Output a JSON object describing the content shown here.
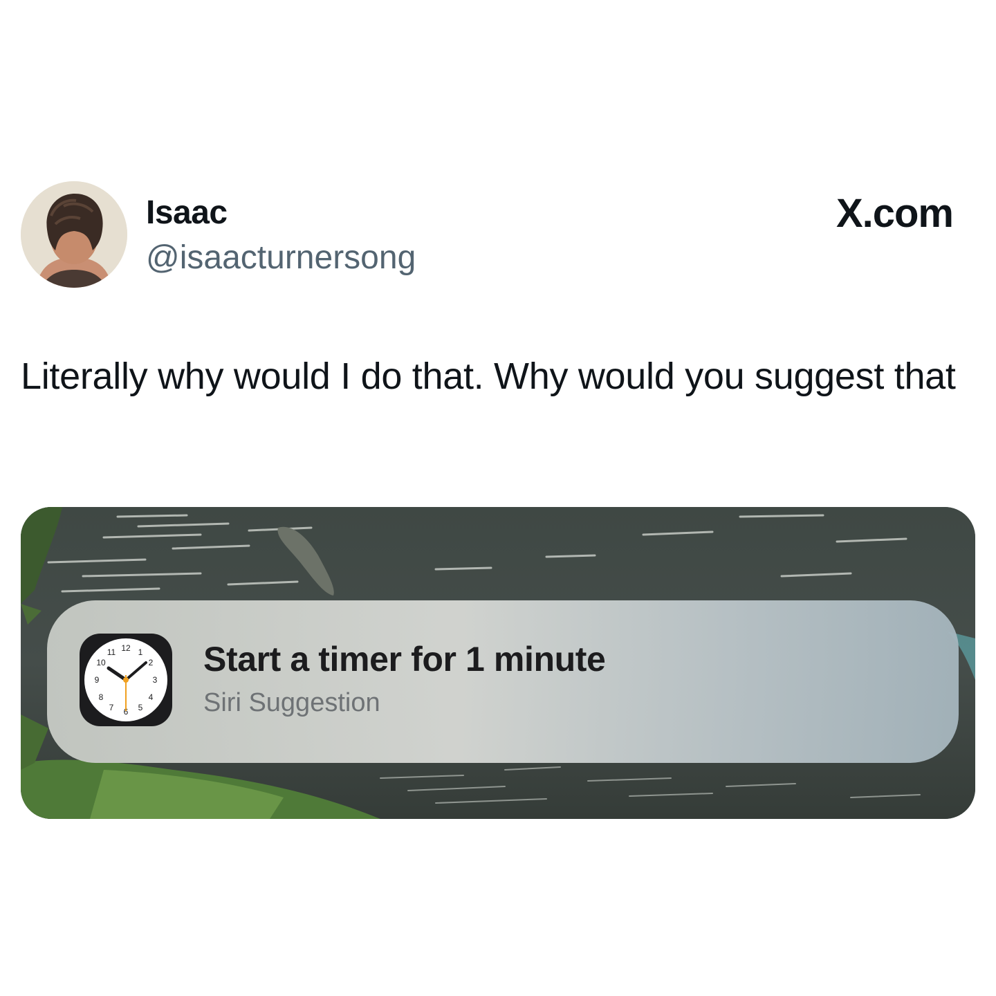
{
  "post": {
    "author_name": "Isaac",
    "author_handle": "@isaacturnersong",
    "site": "X.com",
    "text": "Literally why would I do that. Why would you suggest that"
  },
  "media": {
    "suggestion": {
      "title": "Start a timer for 1 minute",
      "subtitle": "Siri Suggestion",
      "app_icon": "clock-icon",
      "clock_numbers": [
        "12",
        "1",
        "2",
        "3",
        "4",
        "5",
        "6",
        "7",
        "8",
        "9",
        "10",
        "11"
      ]
    }
  },
  "colors": {
    "handle_gray": "#536471",
    "text_dark": "#0f1419",
    "water": "#3d4641",
    "clock_second_hand": "#f0a020"
  }
}
